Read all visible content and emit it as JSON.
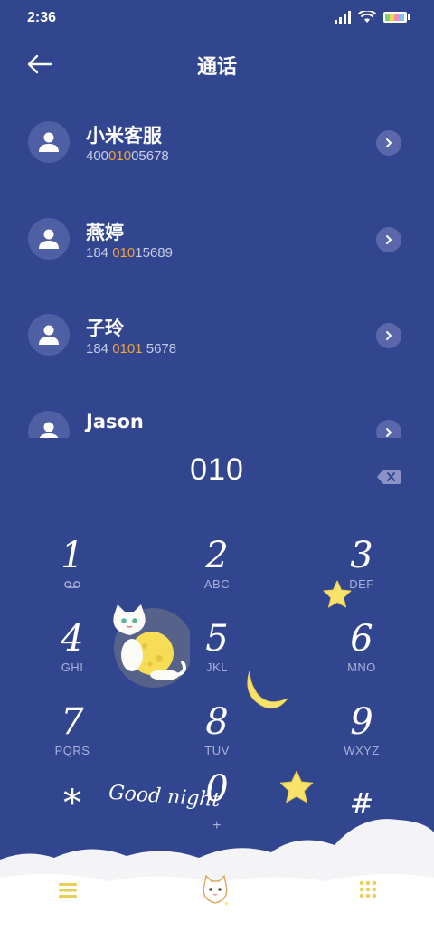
{
  "status_bar": {
    "time": "2:36"
  },
  "header": {
    "title": "通话"
  },
  "contacts": [
    {
      "name": "小米客服",
      "number_before": "400",
      "number_match": "010",
      "number_after": "05678"
    },
    {
      "name": "燕婷",
      "number_before": "184 ",
      "number_match": "010",
      "number_after": "15689"
    },
    {
      "name": "子玲",
      "number_before": "184 ",
      "number_match": "0101",
      "number_after": " 5678"
    },
    {
      "name": "Jason",
      "number_before": "",
      "number_match": "",
      "number_after": ""
    }
  ],
  "dialer": {
    "display": "010",
    "keys": [
      {
        "digit": "1",
        "letters": ""
      },
      {
        "digit": "2",
        "letters": "ABC"
      },
      {
        "digit": "3",
        "letters": "DEF"
      },
      {
        "digit": "4",
        "letters": "GHI"
      },
      {
        "digit": "5",
        "letters": "JKL"
      },
      {
        "digit": "6",
        "letters": "MNO"
      },
      {
        "digit": "7",
        "letters": "PQRS"
      },
      {
        "digit": "8",
        "letters": "TUV"
      },
      {
        "digit": "9",
        "letters": "WXYZ"
      },
      {
        "digit": "*",
        "letters": ""
      },
      {
        "digit": "0",
        "letters": "+"
      },
      {
        "digit": "#",
        "letters": ""
      }
    ]
  },
  "decoration": {
    "caption": "Good night"
  },
  "colors": {
    "background": "#324690",
    "highlight": "#f2a23a",
    "star": "#f7e26b"
  }
}
